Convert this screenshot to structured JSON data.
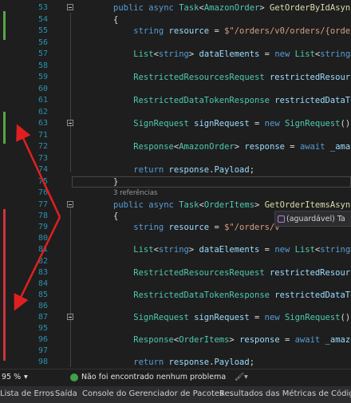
{
  "code_lines": [
    {
      "ln": "53",
      "tokens": [
        [
          "kw",
          "public async "
        ],
        [
          "ty",
          "Task"
        ],
        [
          "pl",
          "<"
        ],
        [
          "ty",
          "AmazonOrder"
        ],
        [
          "pl",
          "> "
        ],
        [
          "fn",
          "GetOrderByIdAsync"
        ]
      ]
    },
    {
      "ln": "54",
      "tokens": [
        [
          "pl",
          "{"
        ]
      ]
    },
    {
      "ln": "55",
      "tokens": [
        [
          "kw",
          "    string "
        ],
        [
          "va",
          "resource"
        ],
        [
          "pl",
          " = "
        ],
        [
          "st",
          "$\"/orders/v0/orders/{order"
        ]
      ]
    },
    {
      "ln": "56",
      "tokens": []
    },
    {
      "ln": "57",
      "tokens": [
        [
          "ty",
          "    List"
        ],
        [
          "pl",
          "<"
        ],
        [
          "kw",
          "string"
        ],
        [
          "pl",
          "> "
        ],
        [
          "va",
          "dataElements"
        ],
        [
          "pl",
          " = "
        ],
        [
          "kw",
          "new "
        ],
        [
          "ty",
          "List"
        ],
        [
          "pl",
          "<"
        ],
        [
          "kw",
          "string"
        ],
        [
          "pl",
          ">"
        ]
      ]
    },
    {
      "ln": "58",
      "tokens": []
    },
    {
      "ln": "59",
      "tokens": [
        [
          "ty",
          "    RestrictedResourcesRequest "
        ],
        [
          "va",
          "restrictedResourc"
        ]
      ]
    },
    {
      "ln": "60",
      "tokens": []
    },
    {
      "ln": "61",
      "tokens": [
        [
          "ty",
          "    RestrictedDataTokenResponse "
        ],
        [
          "va",
          "restrictedDataTo"
        ]
      ]
    },
    {
      "ln": "62",
      "tokens": []
    },
    {
      "ln": "63",
      "tokens": [
        [
          "ty",
          "    SignRequest "
        ],
        [
          "va",
          "signRequest"
        ],
        [
          "pl",
          " = "
        ],
        [
          "kw",
          "new "
        ],
        [
          "ty",
          "SignRequest"
        ],
        [
          "pl",
          "()"
        ]
      ]
    },
    {
      "ln": "71",
      "tokens": []
    },
    {
      "ln": "72",
      "tokens": [
        [
          "ty",
          "    Response"
        ],
        [
          "pl",
          "<"
        ],
        [
          "ty",
          "AmazonOrder"
        ],
        [
          "pl",
          "> "
        ],
        [
          "va",
          "response"
        ],
        [
          "pl",
          " = "
        ],
        [
          "kw",
          "await "
        ],
        [
          "va",
          "_amaz"
        ]
      ]
    },
    {
      "ln": "73",
      "tokens": []
    },
    {
      "ln": "74",
      "tokens": [
        [
          "kw",
          "    return "
        ],
        [
          "va",
          "response"
        ],
        [
          "pl",
          "."
        ],
        [
          "va",
          "Payload"
        ],
        [
          "pl",
          ";"
        ]
      ]
    },
    {
      "ln": "75",
      "tokens": [
        [
          "pl",
          "}"
        ]
      ]
    },
    {
      "ln": "76",
      "tokens": []
    },
    {
      "ln": "77",
      "tokens": [
        [
          "kw",
          "public async "
        ],
        [
          "ty",
          "Task"
        ],
        [
          "pl",
          "<"
        ],
        [
          "ty",
          "OrderItems"
        ],
        [
          "pl",
          "> "
        ],
        [
          "fn",
          "GetOrderItemsAsync"
        ]
      ]
    },
    {
      "ln": "78",
      "tokens": [
        [
          "pl",
          "{"
        ]
      ]
    },
    {
      "ln": "79",
      "tokens": [
        [
          "kw",
          "    string "
        ],
        [
          "va",
          "resource"
        ],
        [
          "pl",
          " = "
        ],
        [
          "st",
          "$\"/orders/v"
        ]
      ]
    },
    {
      "ln": "80",
      "tokens": []
    },
    {
      "ln": "81",
      "tokens": [
        [
          "ty",
          "    List"
        ],
        [
          "pl",
          "<"
        ],
        [
          "kw",
          "string"
        ],
        [
          "pl",
          "> "
        ],
        [
          "va",
          "dataElements"
        ],
        [
          "pl",
          " = "
        ],
        [
          "kw",
          "new "
        ],
        [
          "ty",
          "List"
        ],
        [
          "pl",
          "<"
        ],
        [
          "kw",
          "string"
        ],
        [
          "pl",
          ">"
        ]
      ]
    },
    {
      "ln": "82",
      "tokens": []
    },
    {
      "ln": "83",
      "tokens": [
        [
          "ty",
          "    RestrictedResourcesRequest "
        ],
        [
          "va",
          "restrictedResourc"
        ]
      ]
    },
    {
      "ln": "84",
      "tokens": []
    },
    {
      "ln": "85",
      "tokens": [
        [
          "ty",
          "    RestrictedDataTokenResponse "
        ],
        [
          "va",
          "restrictedDataTo"
        ]
      ]
    },
    {
      "ln": "86",
      "tokens": []
    },
    {
      "ln": "87",
      "tokens": [
        [
          "ty",
          "    SignRequest "
        ],
        [
          "va",
          "signRequest"
        ],
        [
          "pl",
          " = "
        ],
        [
          "kw",
          "new "
        ],
        [
          "ty",
          "SignRequest"
        ],
        [
          "pl",
          "()"
        ]
      ]
    },
    {
      "ln": "95",
      "tokens": []
    },
    {
      "ln": "96",
      "tokens": [
        [
          "ty",
          "    Response"
        ],
        [
          "pl",
          "<"
        ],
        [
          "ty",
          "OrderItems"
        ],
        [
          "pl",
          "> "
        ],
        [
          "va",
          "response"
        ],
        [
          "pl",
          " = "
        ],
        [
          "kw",
          "await "
        ],
        [
          "va",
          "_amazo"
        ]
      ]
    },
    {
      "ln": "97",
      "tokens": []
    },
    {
      "ln": "98",
      "tokens": [
        [
          "kw",
          "    return "
        ],
        [
          "va",
          "response"
        ],
        [
          "pl",
          "."
        ],
        [
          "va",
          "Payload"
        ],
        [
          "pl",
          ";"
        ]
      ]
    },
    {
      "ln": "99",
      "tokens": [
        [
          "pl",
          "}"
        ]
      ]
    }
  ],
  "references_label": "3 referências",
  "tooltip": {
    "text": "(aguardável) Ta",
    "icon": "method-icon"
  },
  "status": {
    "zoom": "95 %",
    "zoom_arrow": "▾",
    "message": "Não foi encontrado nenhum problema",
    "icon": "check-circle-icon",
    "tool": "brush-icon"
  },
  "tabs": [
    "Lista de Erros",
    "Saída",
    "Console do Gerenciador de Pacotes",
    "Resultados das Métricas de Código"
  ],
  "colors": {
    "annotation_arrow": "#e02020",
    "line_number": "#2b91af",
    "change_saved": "#57a64a",
    "change_unsaved": "#d13438"
  }
}
